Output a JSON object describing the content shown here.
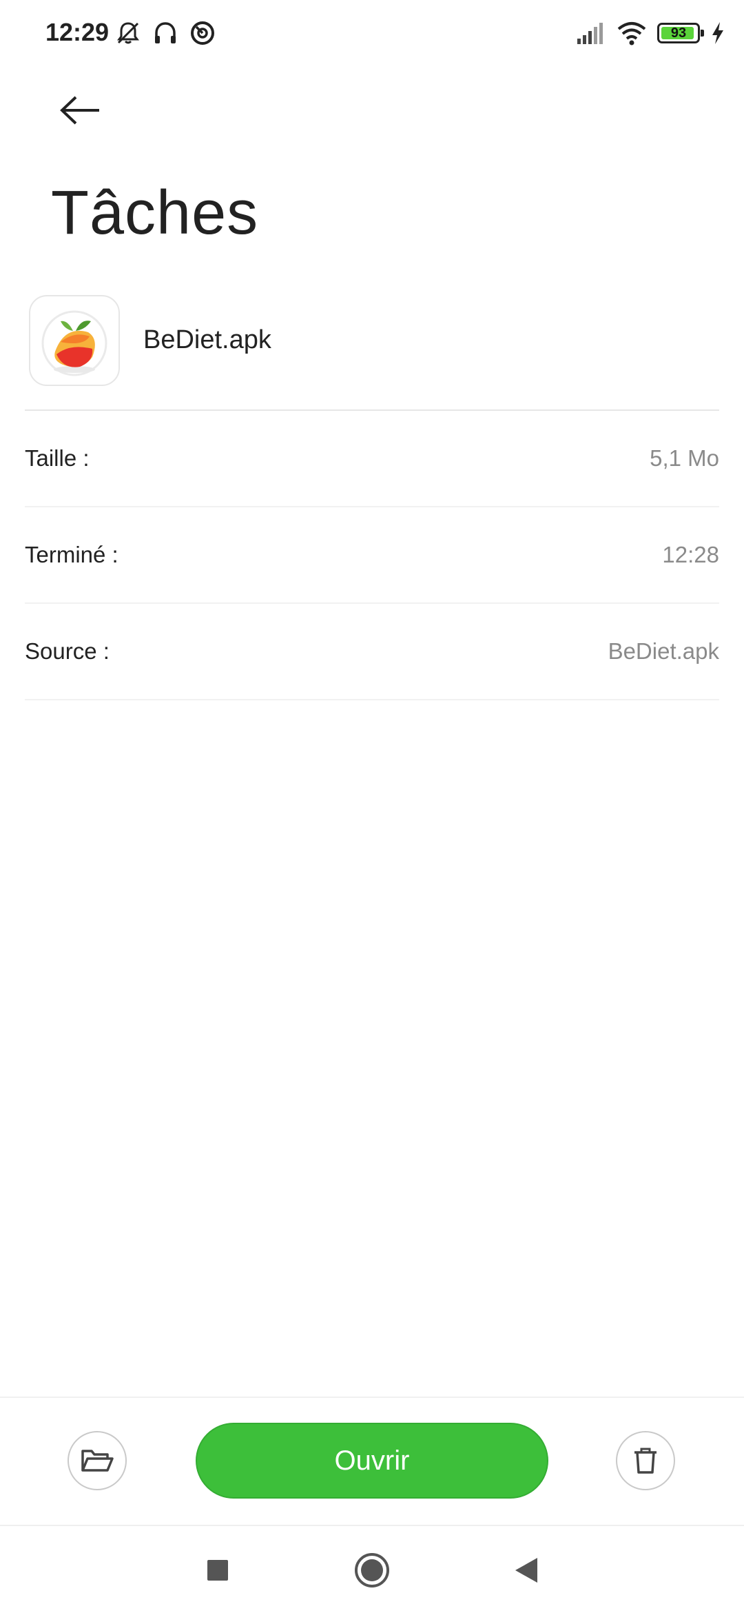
{
  "status_bar": {
    "time": "12:29",
    "battery_level": "93",
    "battery_fraction": 0.93,
    "left_icons": [
      "bell-muted-icon",
      "headphones-icon",
      "dnd-icon"
    ],
    "right_icons": [
      "signal-icon",
      "wifi-icon",
      "battery-icon",
      "charging-icon"
    ]
  },
  "header": {
    "back_icon": "arrow-left-icon",
    "title": "Tâches"
  },
  "app": {
    "icon": "fruit-app-icon",
    "name": "BeDiet.apk"
  },
  "details": [
    {
      "label": "Taille :",
      "value": "5,1 Mo"
    },
    {
      "label": "Terminé :",
      "value": "12:28"
    },
    {
      "label": "Source :",
      "value": "BeDiet.apk"
    }
  ],
  "actions": {
    "folder_icon": "folder-open-icon",
    "open_label": "Ouvrir",
    "delete_icon": "trash-icon",
    "accent_color": "#3dbf3a"
  },
  "nav": [
    "recents-square-icon",
    "home-circle-icon",
    "back-triangle-icon"
  ]
}
